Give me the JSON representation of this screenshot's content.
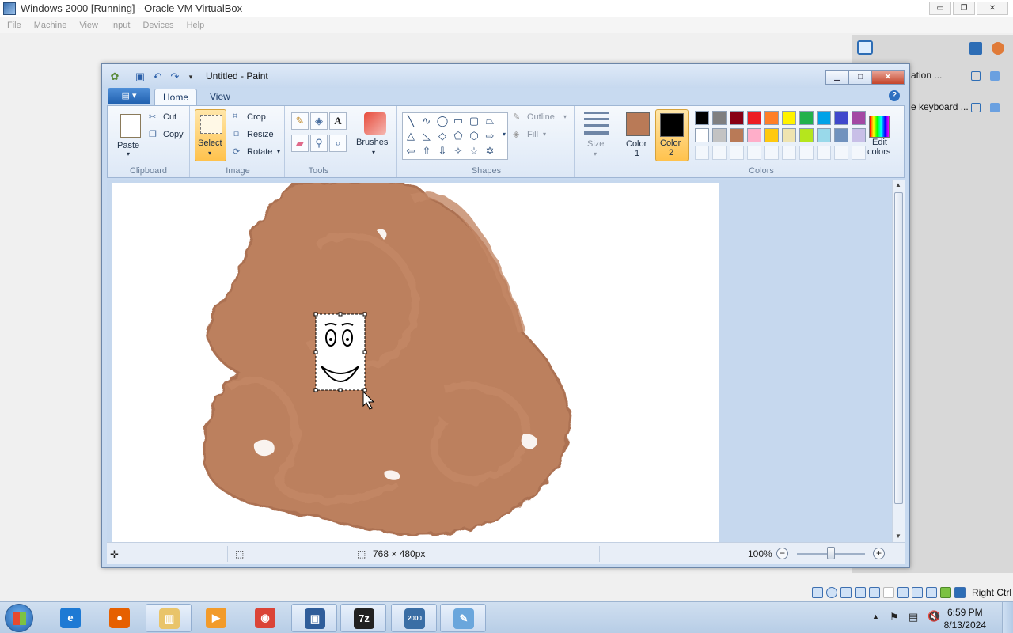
{
  "host": {
    "title": "Windows 2000 [Running] - Oracle VM VirtualBox",
    "menu": [
      "File",
      "Machine",
      "View",
      "Input",
      "Devices",
      "Help"
    ],
    "window_buttons": {
      "minimize": "▭",
      "restore": "❐",
      "close": "✕"
    }
  },
  "notifications": {
    "items": [
      {
        "text": "ation ..."
      },
      {
        "text": "e keyboard ..."
      }
    ]
  },
  "paint": {
    "title": "Untitled - Paint",
    "tabs": {
      "menu_label": "▤ ▾",
      "home": "Home",
      "view": "View"
    },
    "help": "?",
    "clipboard": {
      "paste": "Paste",
      "cut": "Cut",
      "copy": "Copy",
      "group": "Clipboard"
    },
    "image": {
      "select": "Select",
      "crop": "Crop",
      "resize": "Resize",
      "rotate": "Rotate",
      "group": "Image"
    },
    "tools": {
      "group": "Tools"
    },
    "brushes": {
      "label": "Brushes"
    },
    "shapes": {
      "outline": "Outline",
      "fill": "Fill",
      "group": "Shapes"
    },
    "size": {
      "label": "Size"
    },
    "colors": {
      "color1_label": "Color",
      "color1_num": "1",
      "color2_label": "Color",
      "color2_num": "2",
      "color1_value": "#b97a57",
      "color2_value": "#000000",
      "edit_colors_1": "Edit",
      "edit_colors_2": "colors",
      "group": "Colors",
      "palette_row1": [
        "#000000",
        "#7f7f7f",
        "#880015",
        "#ed1c24",
        "#ff7f27",
        "#fff200",
        "#22b14c",
        "#00a2e8",
        "#3f48cc",
        "#a349a4"
      ],
      "palette_row2": [
        "#ffffff",
        "#c3c3c3",
        "#b97a57",
        "#ffaec9",
        "#ffc90e",
        "#efe4b0",
        "#b5e61d",
        "#99d9ea",
        "#7092be",
        "#c8bfe7"
      ]
    },
    "status": {
      "dimensions": "768 × 480px",
      "zoom": "100%",
      "zoom_out": "−",
      "zoom_in": "+"
    }
  },
  "guest_tray": {
    "host_key": "Right Ctrl"
  },
  "taskbar": {
    "apps": [
      {
        "name": "internet-explorer",
        "glyph": "e",
        "color": "#1e7ad4"
      },
      {
        "name": "firefox",
        "glyph": "●",
        "color": "#e66000"
      },
      {
        "name": "file-explorer",
        "glyph": "▥",
        "color": "#e9c46a"
      },
      {
        "name": "media-player",
        "glyph": "▶",
        "color": "#f29b2a"
      },
      {
        "name": "chrome",
        "glyph": "◉",
        "color": "#db4437"
      },
      {
        "name": "virtualbox",
        "glyph": "▣",
        "color": "#2f5d9a"
      },
      {
        "name": "7zip",
        "glyph": "7z",
        "color": "#222222"
      },
      {
        "name": "windows-2000",
        "glyph": "2000",
        "color": "#3a6ea5"
      },
      {
        "name": "paint",
        "glyph": "✎",
        "color": "#6aa6dc"
      }
    ],
    "time": "6:59 PM",
    "date": "8/13/2024"
  }
}
